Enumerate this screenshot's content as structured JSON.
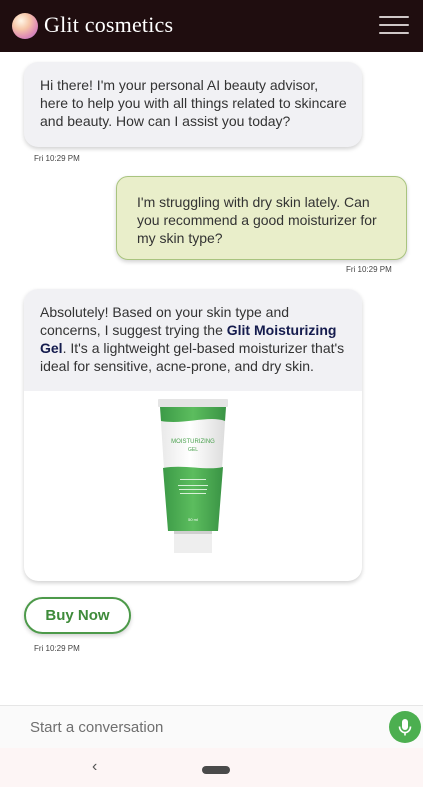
{
  "header": {
    "title": "Glit cosmetics",
    "logo_icon": "sphere-logo-icon",
    "menu_icon": "hamburger-menu-icon"
  },
  "messages": [
    {
      "sender": "bot",
      "text": "Hi there! I'm your personal AI beauty advisor, here to help you with all things related to skincare and beauty. How can I assist you today?",
      "time": "Fri 10:29 PM"
    },
    {
      "sender": "user",
      "text": "I'm struggling with dry skin lately. Can you recommend a good moisturizer for my skin type?",
      "time": "Fri 10:29 PM"
    },
    {
      "sender": "bot",
      "text_before": "Absolutely! Based on your skin type and concerns, I suggest trying the ",
      "product_name": "Glit Moisturizing Gel",
      "text_after": ". It's a lightweight gel-based moisturizer that's ideal for sensitive, acne-prone, and dry skin.",
      "product_image_text": {
        "title": "MOISTURIZING",
        "subtitle": "GEL",
        "volume": "50 ml"
      },
      "time": "Fri 10:29 PM"
    }
  ],
  "buy_button": {
    "label": "Buy Now"
  },
  "input": {
    "placeholder": "Start a conversation",
    "mic_icon": "microphone-icon"
  },
  "nav": {
    "back_glyph": "‹",
    "back_icon": "back-chevron-icon",
    "home_icon": "home-pill-icon"
  },
  "colors": {
    "header_bg": "#1f0d0f",
    "bot_bubble": "#f1f1f4",
    "user_bubble": "#e9eeca",
    "user_border": "#a9c47f",
    "accent_green": "#4caf50",
    "product_name": "#141b4d"
  }
}
